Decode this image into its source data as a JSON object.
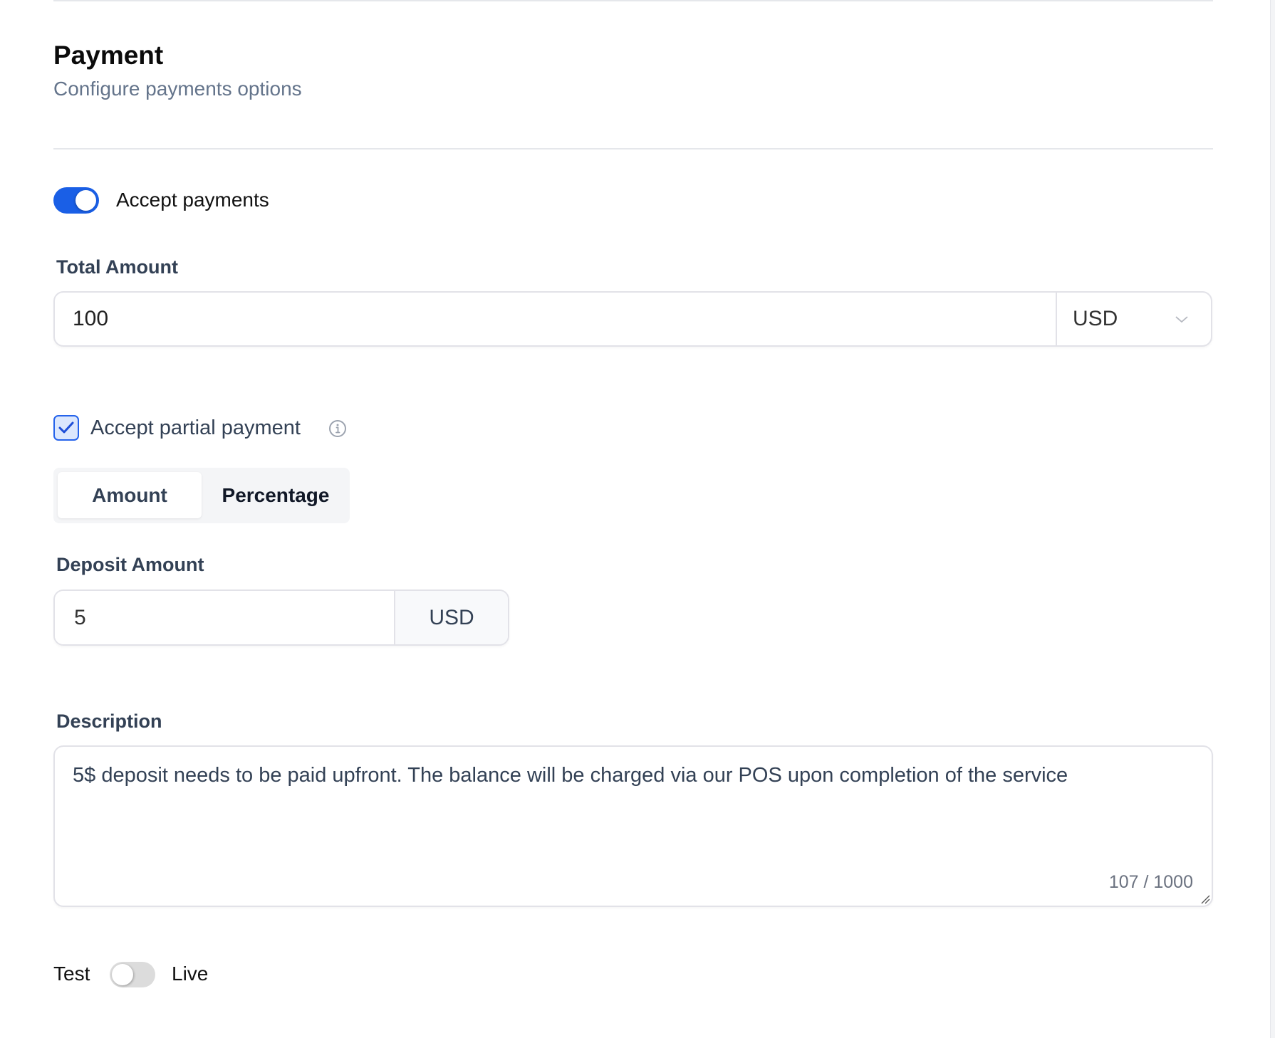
{
  "section": {
    "title": "Payment",
    "subtitle": "Configure payments options"
  },
  "accept_payments": {
    "label": "Accept payments",
    "enabled": true
  },
  "total_amount": {
    "label": "Total Amount",
    "value": "100",
    "currency": "USD"
  },
  "partial_payment": {
    "label": "Accept partial payment",
    "checked": true,
    "info_icon": "info-circle-icon"
  },
  "deposit_type": {
    "options": [
      "Amount",
      "Percentage"
    ],
    "selected": "Amount"
  },
  "deposit_amount": {
    "label": "Deposit Amount",
    "value": "5",
    "currency": "USD"
  },
  "description": {
    "label": "Description",
    "value": "5$ deposit needs to be paid upfront. The balance will be charged via our POS upon completion of the service",
    "counter": "107 / 1000"
  },
  "mode": {
    "left_label": "Test",
    "right_label": "Live",
    "live": false
  },
  "colors": {
    "accent": "#1a5fe6",
    "label": "#334155",
    "muted": "#64748b",
    "border": "#e2e2e8"
  }
}
